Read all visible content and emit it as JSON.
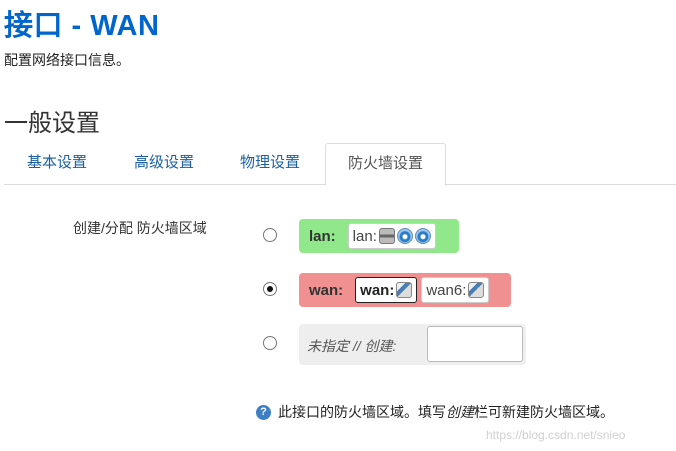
{
  "page": {
    "title": "接口 - WAN",
    "description": "配置网络接口信息。",
    "section_title": "一般设置"
  },
  "tabs": [
    {
      "label": "基本设置"
    },
    {
      "label": "高级设置"
    },
    {
      "label": "物理设置"
    },
    {
      "label": "防火墙设置"
    }
  ],
  "firewall": {
    "field_label": "创建/分配 防火墙区域",
    "zones": [
      {
        "name": "lan:",
        "color": "#90e88a",
        "selected": false,
        "interfaces": [
          {
            "label": "lan:",
            "icons": [
              "switch-icon",
              "wifi-icon",
              "wifi-icon"
            ]
          }
        ]
      },
      {
        "name": "wan:",
        "color": "#f09090",
        "selected": true,
        "interfaces": [
          {
            "label": "wan:",
            "icons": [
              "ethernet-icon"
            ]
          },
          {
            "label": "wan6:",
            "icons": [
              "ethernet-icon"
            ]
          }
        ]
      }
    ],
    "new_zone_label": "未指定 // 创建:",
    "new_zone_value": ""
  },
  "help": {
    "text_before": "此接口的防火墙区域。填写",
    "text_em": "创建",
    "text_after": "栏可新建防火墙区域。"
  },
  "watermark": "https://blog.csdn.net/snieo"
}
